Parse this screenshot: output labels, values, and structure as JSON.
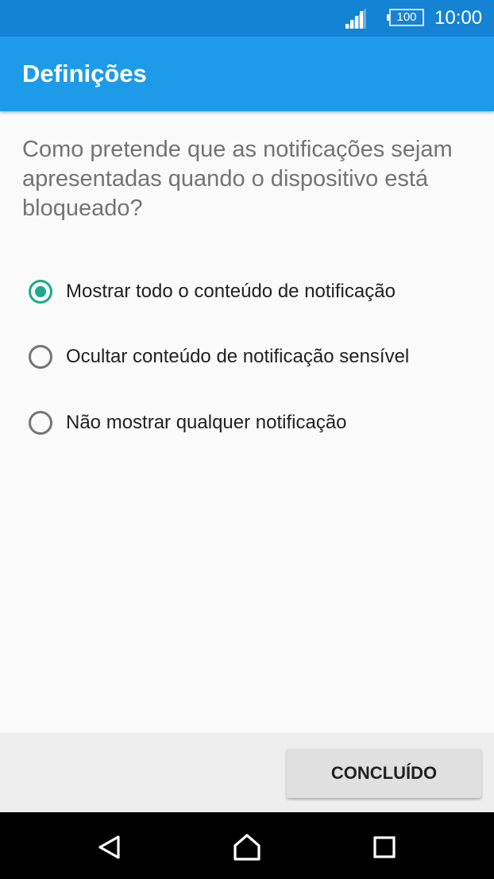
{
  "status_bar": {
    "time": "10:00",
    "battery_level": "100",
    "signal_icon": "cellular-signal-icon",
    "battery_icon": "battery-icon",
    "color": "#1583d4"
  },
  "app_bar": {
    "title": "Definições",
    "color": "#1e9be8"
  },
  "question": "Como pretende que as notificações sejam apresentadas quando o dispositivo está bloqueado?",
  "options": [
    {
      "label": "Mostrar todo o conteúdo de notificação",
      "selected": true
    },
    {
      "label": "Ocultar conteúdo de notificação sensível",
      "selected": false
    },
    {
      "label": "Não mostrar qualquer notificação",
      "selected": false
    }
  ],
  "accent_color": "#1aaa8e",
  "footer": {
    "done_label": "CONCLUÍDO"
  },
  "nav_bar": {
    "back_icon": "back-triangle-icon",
    "home_icon": "home-icon",
    "recents_icon": "recents-square-icon"
  }
}
